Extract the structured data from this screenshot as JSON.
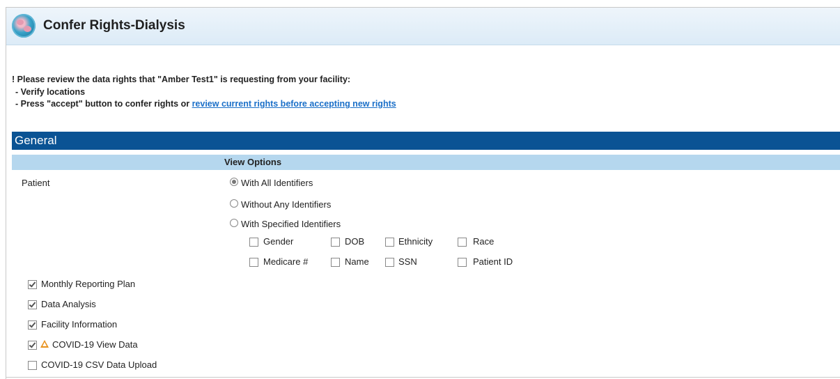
{
  "header": {
    "title": "Confer Rights-Dialysis"
  },
  "message": {
    "line1": "! Please review the data rights that \"Amber Test1\" is requesting from your facility:",
    "line2": "- Verify locations",
    "line3_prefix": "- Press \"accept\" button to confer rights or ",
    "line3_link": "review current rights before accepting new rights"
  },
  "section": {
    "title": "General",
    "column_header": "View Options"
  },
  "patient": {
    "label": "Patient",
    "options": [
      "With All Identifiers",
      "Without Any Identifiers",
      "With Specified Identifiers"
    ],
    "selected_option": "With All Identifiers",
    "identifiers": [
      "Gender",
      "DOB",
      "Ethnicity",
      "Race",
      "Medicare #",
      "Name",
      "SSN",
      "Patient ID"
    ]
  },
  "rights": [
    {
      "label": "Monthly Reporting Plan",
      "checked": true
    },
    {
      "label": "Data Analysis",
      "checked": true
    },
    {
      "label": "Facility Information",
      "checked": true
    },
    {
      "label": "COVID-19 View Data",
      "checked": true,
      "warning_icon": "warning-icon"
    },
    {
      "label": "COVID-19 CSV Data Upload",
      "checked": false
    }
  ],
  "colors": {
    "section_bar": "#0a5394",
    "subheader": "#b5d7ee",
    "link": "#1a6fc8",
    "warning": "#e8911b"
  }
}
